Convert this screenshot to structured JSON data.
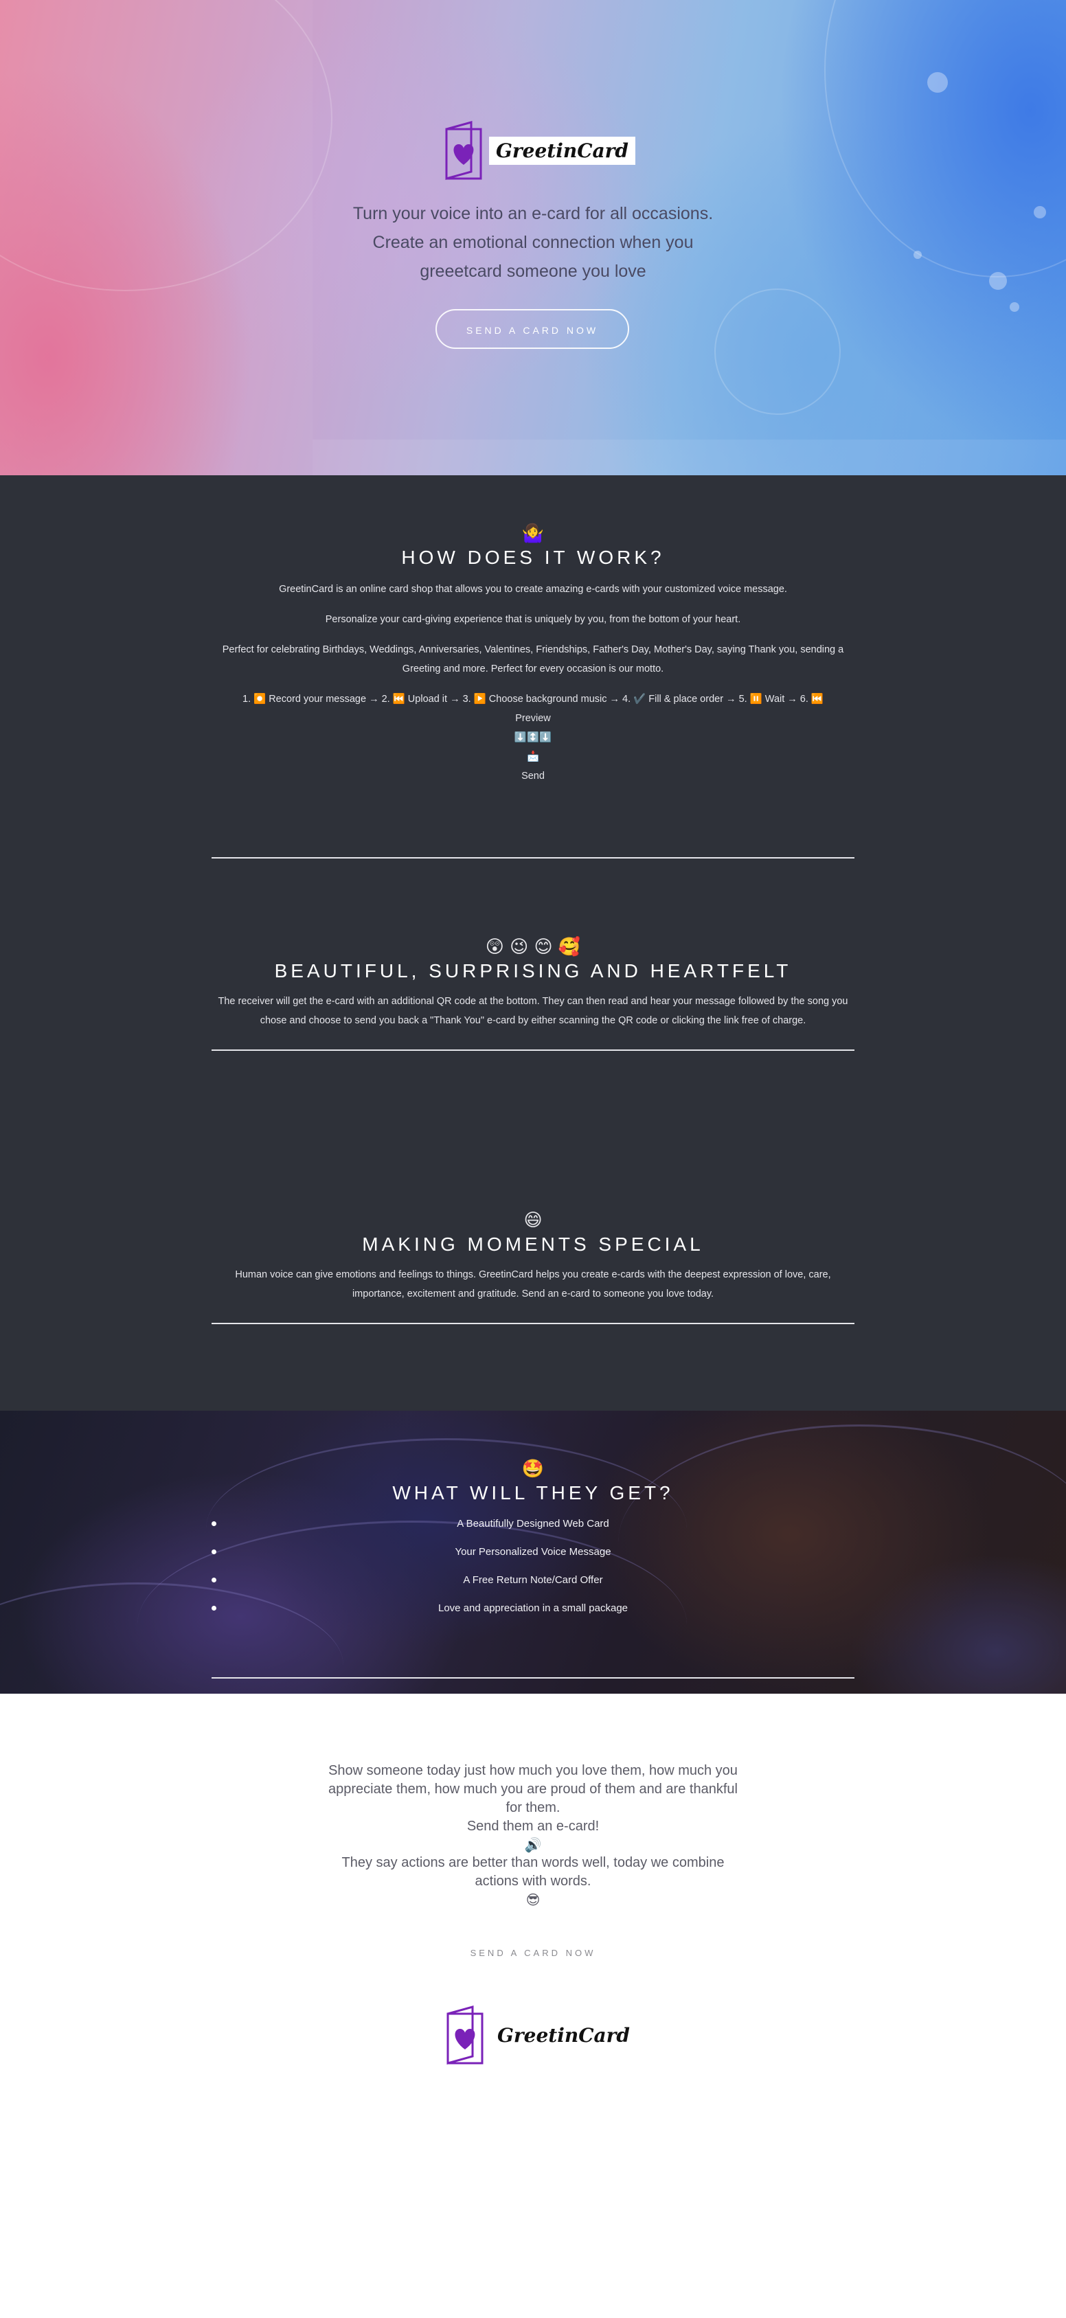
{
  "brand": {
    "name": "GreetinCard",
    "accent": "#7a22b8",
    "icon": "greeting-card-heart-icon"
  },
  "hero": {
    "tagline": [
      "Turn your voice into an e-card for all occasions.",
      "Create an emotional connection when you",
      "greeetcard someone you love"
    ],
    "cta": "SEND A CARD NOW"
  },
  "how": {
    "emoji": "🤷‍♀️",
    "title": "HOW DOES IT WORK?",
    "p1": "GreetinCard is an online card shop that allows you to create amazing e-cards with your customized voice message.",
    "p2": "Personalize your card-giving experience that is uniquely by you, from the bottom of your heart.",
    "p3": "Perfect for celebrating Birthdays, Weddings, Anniversaries, Valentines, Friendships, Father's Day, Mother's Day, saying Thank you, sending a Greeting and more. Perfect for every occasion is our motto.",
    "steps": "1. ⏺️ Record your message → 2. ⏮️ Upload it → 3. ▶️ Choose background music → 4. ✔️ Fill & place order → 5. ⏸️ Wait → 6. ⏮️",
    "preview": "Preview",
    "arrows": "⬇️↕️⬇️",
    "envelope": "📩",
    "send": "Send"
  },
  "beautiful": {
    "emoji": "😲 😉 😊 🥰",
    "title": "BEAUTIFUL, SURPRISING AND HEARTFELT",
    "text": "The receiver will get the e-card with an additional QR code at the bottom. They can then read and hear your message followed by the song you chose and choose to send you back a \"Thank You\" e-card by either scanning the QR code or clicking the link free of charge."
  },
  "moments": {
    "emoji": "😄",
    "title": "MAKING MOMENTS SPECIAL",
    "text": "Human voice can give emotions and feelings to things. GreetinCard helps you create e-cards with the deepest expression of love, care, importance, excitement and gratitude. Send an e-card to someone you love today."
  },
  "get": {
    "emoji": "🤩",
    "title": "WHAT WILL THEY GET?",
    "items": [
      "A Beautifully Designed Web Card",
      "Your Personalized Voice Message",
      "A Free Return Note/Card Offer",
      "Love and appreciation in a small package"
    ]
  },
  "outro": {
    "line1": "Show someone today just how much you love them, how much you appreciate them, how much you are proud of them and are thankful for them.",
    "line2": "Send them an e-card!",
    "emoji1": "🔊",
    "line3": "They say actions are better than words well, today we combine actions with words.",
    "emoji2": "😎",
    "cta": "SEND A CARD NOW"
  }
}
